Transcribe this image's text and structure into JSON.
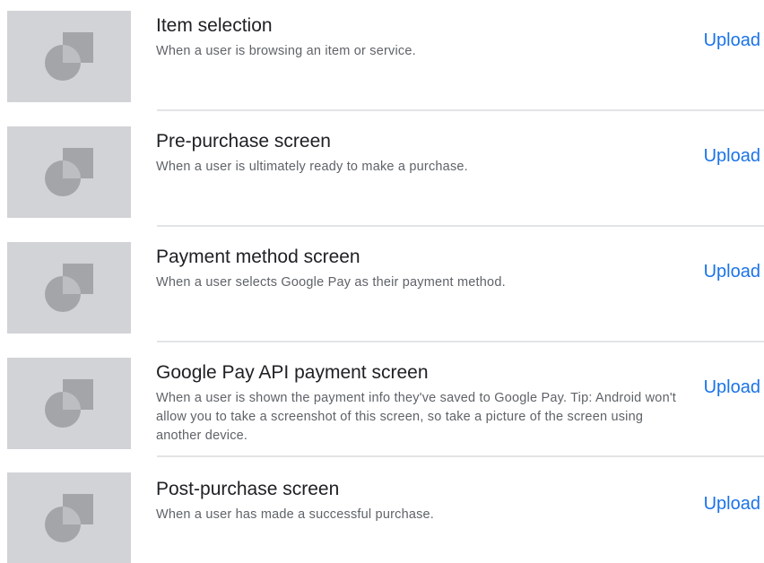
{
  "screens": [
    {
      "title": "Item selection",
      "description": "When a user is browsing an item or service.",
      "action": "Upload",
      "icon": "image-placeholder-icon"
    },
    {
      "title": "Pre-purchase screen",
      "description": "When a user is ultimately ready to make a purchase.",
      "action": "Upload",
      "icon": "image-placeholder-icon"
    },
    {
      "title": "Payment method screen",
      "description": "When a user selects Google Pay as their payment method.",
      "action": "Upload",
      "icon": "image-placeholder-icon"
    },
    {
      "title": "Google Pay API payment screen",
      "description": "When a user is shown the payment info they've saved to Google Pay. Tip: Android won't allow you to take a screenshot of this screen, so take a picture of the screen using another device.",
      "action": "Upload",
      "icon": "image-placeholder-icon"
    },
    {
      "title": "Post-purchase screen",
      "description": "When a user has made a successful purchase.",
      "action": "Upload",
      "icon": "image-placeholder-icon"
    }
  ],
  "colors": {
    "accent": "#1a73e8",
    "title_text": "#202124",
    "body_text": "#5f6368",
    "placeholder_bg": "#d2d3d7",
    "placeholder_icon": "#a4a5a9",
    "divider": "#e3e4e6"
  }
}
